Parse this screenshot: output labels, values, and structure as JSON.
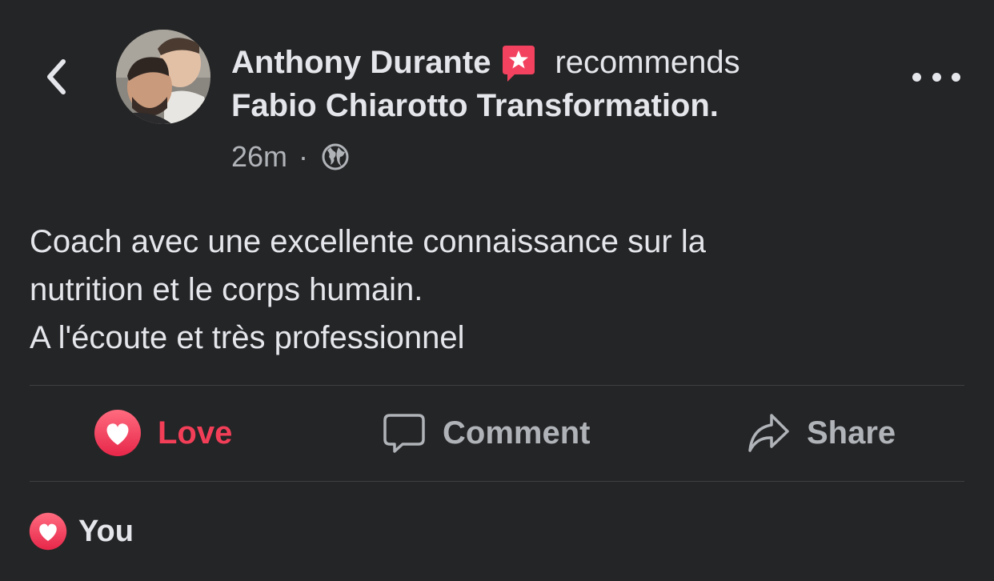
{
  "post": {
    "author": "Anthony Durante",
    "verb": "recommends",
    "page_name": "Fabio Chiarotto Transformation.",
    "time": "26m",
    "separator": "·",
    "body_lines": [
      "Coach avec une excellente connaissance sur la",
      "nutrition et le corps humain.",
      "A l'écoute et très professionnel"
    ]
  },
  "actions": {
    "love_label": "Love",
    "comment_label": "Comment",
    "share_label": "Share"
  },
  "reactions": {
    "summary": "You"
  },
  "icons": {
    "back": "chevron-left-icon",
    "recommend": "recommend-star-icon",
    "audience": "globe-icon",
    "more": "more-dots-icon",
    "love": "heart-icon",
    "comment": "comment-bubble-icon",
    "share": "share-arrow-icon"
  },
  "colors": {
    "background": "#242526",
    "text_primary": "#e4e6eb",
    "text_secondary": "#b0b3b8",
    "love": "#f33e58",
    "recommend_badge": "#f3425f",
    "divider": "#3e4042"
  }
}
